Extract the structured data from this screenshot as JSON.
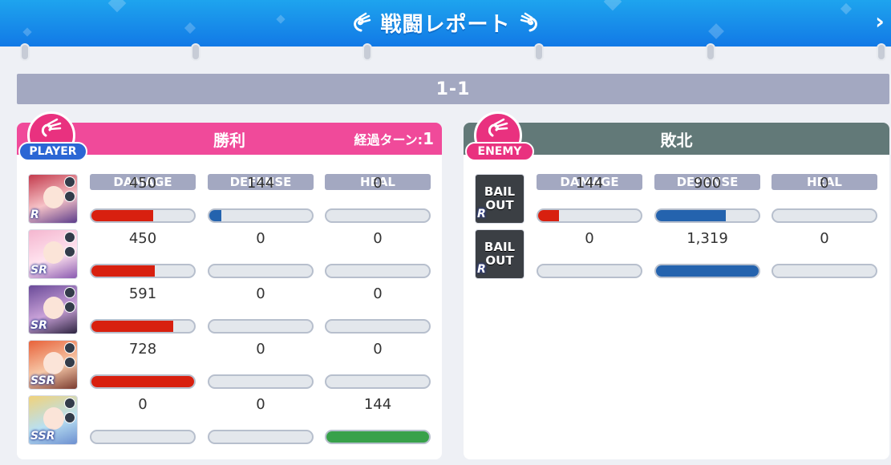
{
  "header": {
    "title": "戦闘レポート"
  },
  "stage": {
    "label": "1-1"
  },
  "player": {
    "badge": "PLAYER",
    "result": "勝利",
    "turns_label": "経過ターン:",
    "turns": "1",
    "columns": [
      "DAMAGE",
      "DEFENSE",
      "HEAL"
    ],
    "units": [
      {
        "rank": "R",
        "damage": "450",
        "defense": "144",
        "heal": "0",
        "damage_pct": 60,
        "defense_pct": 12,
        "heal_pct": 0
      },
      {
        "rank": "SR",
        "damage": "450",
        "defense": "0",
        "heal": "0",
        "damage_pct": 62,
        "defense_pct": 0,
        "heal_pct": 0
      },
      {
        "rank": "SR",
        "damage": "591",
        "defense": "0",
        "heal": "0",
        "damage_pct": 80,
        "defense_pct": 0,
        "heal_pct": 0
      },
      {
        "rank": "SSR",
        "damage": "728",
        "defense": "0",
        "heal": "0",
        "damage_pct": 100,
        "defense_pct": 0,
        "heal_pct": 0
      },
      {
        "rank": "SSR",
        "damage": "0",
        "defense": "0",
        "heal": "144",
        "damage_pct": 0,
        "defense_pct": 0,
        "heal_pct": 100
      }
    ]
  },
  "enemy": {
    "badge": "ENEMY",
    "result": "敗北",
    "columns": [
      "DAMAGE",
      "DEFENSE",
      "HEAL"
    ],
    "units": [
      {
        "line1": "BAIL",
        "line2": "OUT",
        "rank": "R",
        "damage": "144",
        "defense": "900",
        "heal": "0",
        "damage_pct": 20,
        "defense_pct": 68,
        "heal_pct": 0
      },
      {
        "line1": "BAIL",
        "line2": "OUT",
        "rank": "R",
        "damage": "0",
        "defense": "1,319",
        "heal": "0",
        "damage_pct": 0,
        "defense_pct": 100,
        "heal_pct": 0
      }
    ]
  },
  "colors": {
    "damage": "#d8200f",
    "defense": "#2463ae",
    "heal": "#38a14a",
    "player_head": "#f04a9a",
    "enemy_head": "#627978"
  }
}
